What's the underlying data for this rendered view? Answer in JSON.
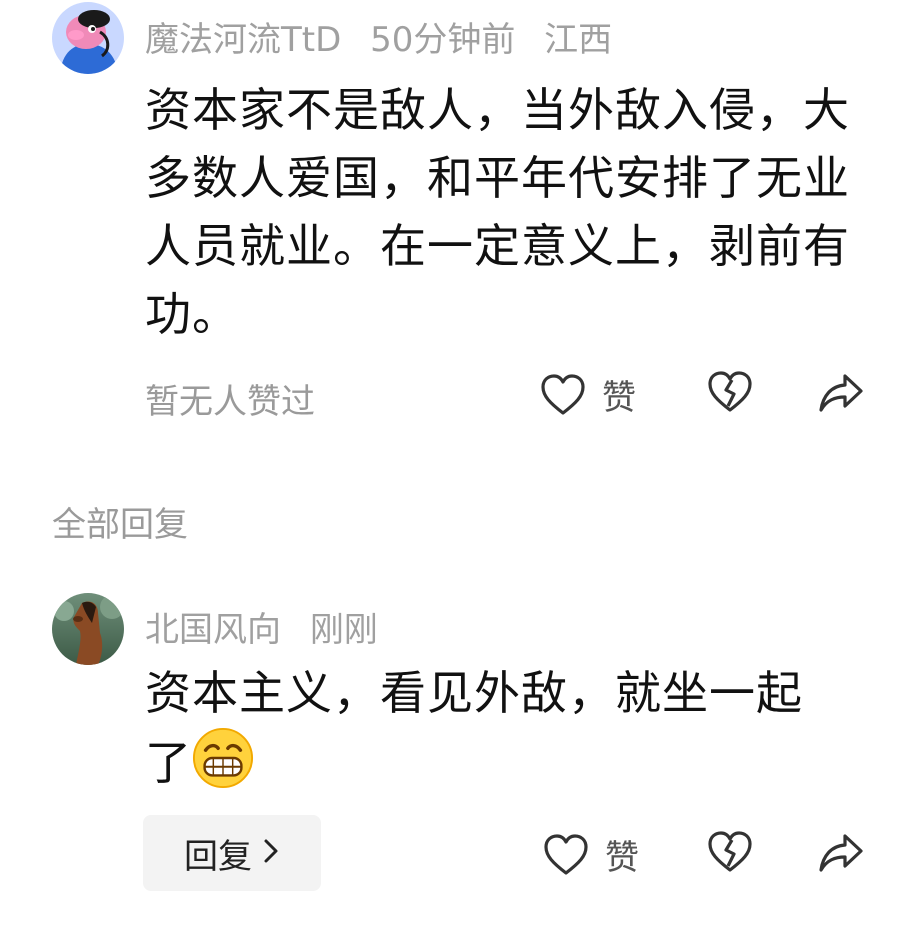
{
  "comments": [
    {
      "username": "魔法河流TtD",
      "time": "50分钟前",
      "location": "江西",
      "text": "资本家不是敌人，当外敌入侵，大多数人爱国，和平年代安排了无业人员就业。在一定意义上，剥前有功。",
      "likes_note": "暂无人赞过",
      "like_label": "赞"
    },
    {
      "username": "北国风向",
      "time": "刚刚",
      "text": "资本主义，看见外敌，就坐一起了",
      "emoji": "grinning-face-emoji",
      "like_label": "赞",
      "reply_label": "回复"
    }
  ],
  "section": {
    "all_replies": "全部回复"
  },
  "icons": {
    "like": "heart-outline-icon",
    "dislike": "broken-heart-icon",
    "share": "share-arrow-icon",
    "chevron": "chevron-right-icon"
  },
  "colors": {
    "meta_gray": "#a0a0a0",
    "text": "#111111",
    "reply_button_bg": "#f3f3f3"
  }
}
